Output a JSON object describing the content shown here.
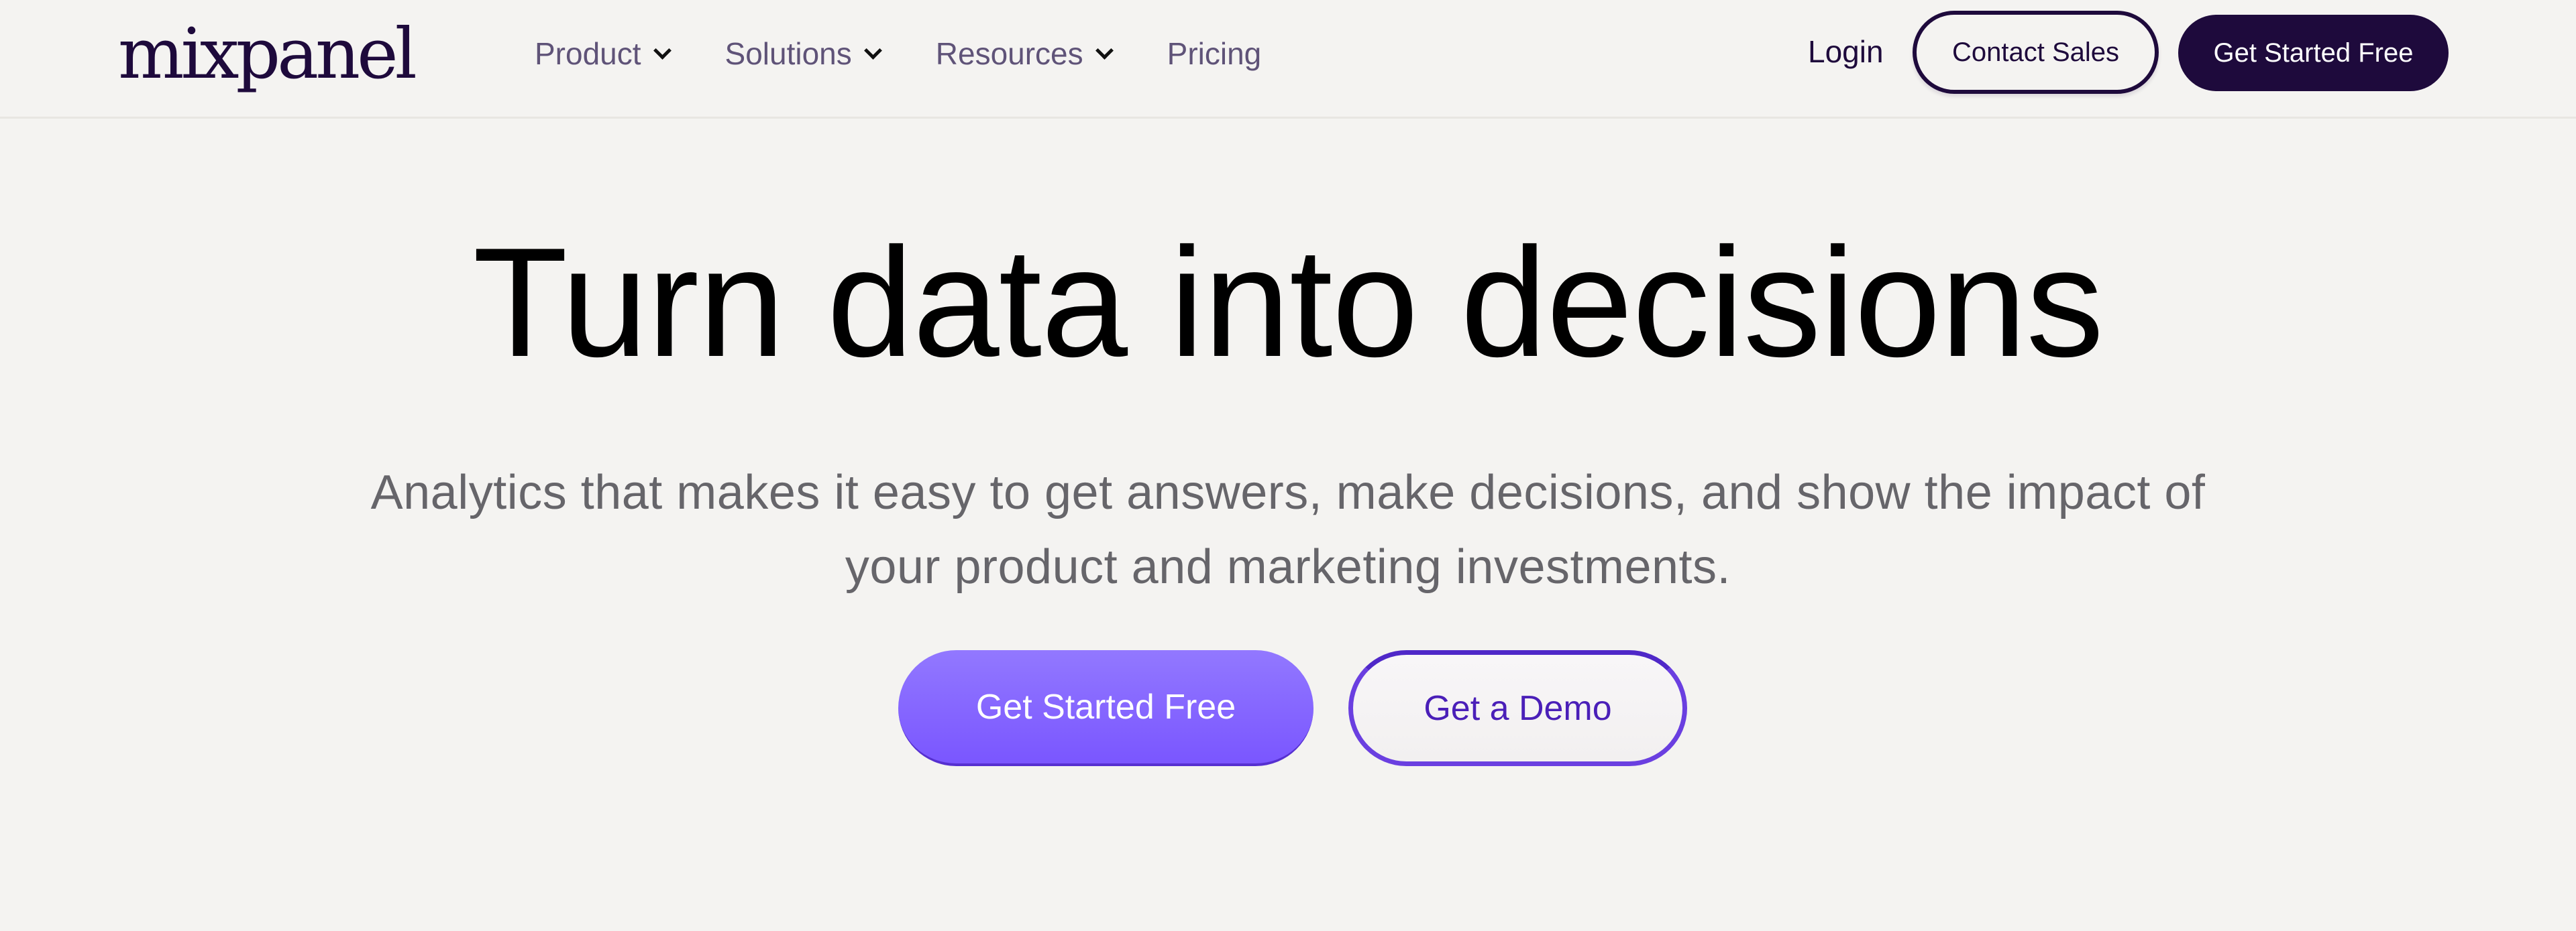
{
  "header": {
    "logo": "mixpanel",
    "nav": [
      {
        "label": "Product",
        "has_dropdown": true,
        "icon": "chevron-down-icon"
      },
      {
        "label": "Solutions",
        "has_dropdown": true,
        "icon": "chevron-down-icon"
      },
      {
        "label": "Resources",
        "has_dropdown": true,
        "icon": "chevron-down-icon"
      },
      {
        "label": "Pricing",
        "has_dropdown": false
      }
    ],
    "login_label": "Login",
    "contact_sales_label": "Contact Sales",
    "get_started_label": "Get Started Free"
  },
  "hero": {
    "headline": "Turn data into decisions",
    "subtitle_line1": "Analytics that makes it easy to get answers, make decisions, and show the impact of",
    "subtitle_line2": "your product and marketing investments.",
    "primary_cta_label": "Get Started Free",
    "secondary_cta_label": "Get a Demo"
  },
  "colors": {
    "background": "#f4f3f1",
    "brand_dark": "#1e0a3c",
    "nav_text": "#5f5378",
    "accent_purple": "#7a56ff",
    "demo_purple": "#4a1fb8",
    "subtitle_gray": "#66656a"
  }
}
